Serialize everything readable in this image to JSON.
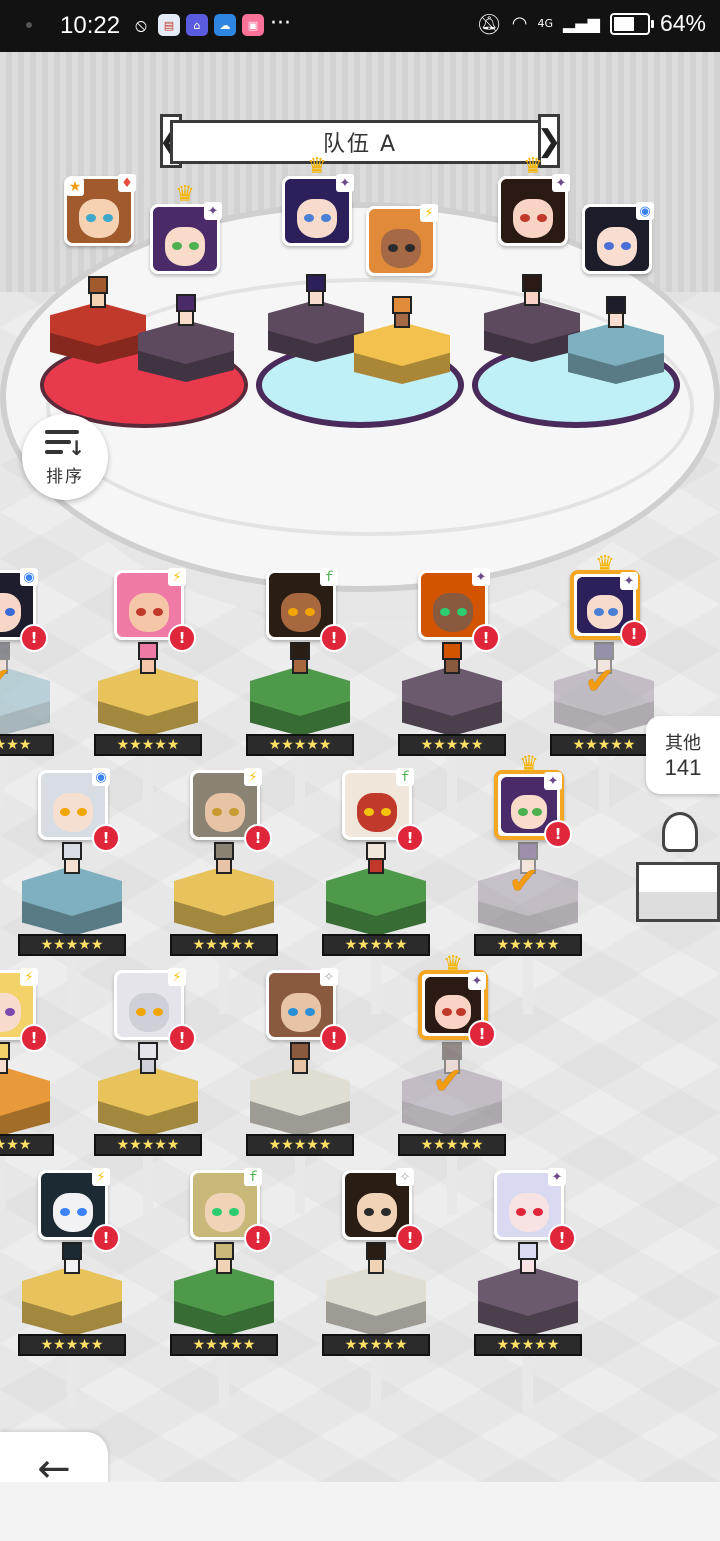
{
  "status_bar": {
    "time": "10:22",
    "network": "4G",
    "battery_percent": "64%",
    "battery_level": 0.64,
    "notification_icons": [
      "nosmoking-icon",
      "gift-icon",
      "wechat-work-icon",
      "cloud-icon",
      "bilibili-icon"
    ],
    "more": "···"
  },
  "team": {
    "title": "队伍 A",
    "prev_arrow": "❮",
    "next_arrow": "❯",
    "slots": [
      {
        "portrait_color": "#a05a2c",
        "skin": "#f6d2b3",
        "eye": "#3fa7c9",
        "element": "♦",
        "element_color": "#e74c3c",
        "rank_badge": "★",
        "pedestal_color": "#c0392b",
        "crown": false
      },
      {
        "portrait_color": "#4b2a6a",
        "skin": "#f8dcc9",
        "eye": "#4caf50",
        "element": "✦",
        "element_color": "#6b4a8a",
        "pedestal_color": "#5d4a5e",
        "crown": true
      },
      {
        "portrait_color": "#2c1f5a",
        "skin": "#f7dccd",
        "eye": "#4a7fd6",
        "element": "✦",
        "element_color": "#6b4a8a",
        "pedestal_color": "#5d4a5e",
        "crown": true
      },
      {
        "portrait_color": "#e08a3a",
        "skin": "#a56a45",
        "eye": "#2a2a2a",
        "element": "⚡",
        "element_color": "#f4c20d",
        "pedestal_color": "#f2c14e",
        "crown": false
      },
      {
        "portrait_color": "#2b1a14",
        "skin": "#f9d4c5",
        "eye": "#c0392b",
        "element": "✦",
        "element_color": "#6b4a8a",
        "pedestal_color": "#5d4a5e",
        "crown": true
      },
      {
        "portrait_color": "#1c1c2a",
        "skin": "#f9ddd0",
        "eye": "#4a6fd6",
        "element": "◉",
        "element_color": "#3b82f6",
        "pedestal_color": "#7fb0c0",
        "crown": false
      }
    ]
  },
  "roster": [
    {
      "hair": "#1d1d2e",
      "skin": "#f8d7c8",
      "eye": "#3b6bd6",
      "element": "◉",
      "element_color": "#3b82f6",
      "pedestal": "#7fb0c0",
      "alert": "!",
      "stars": "★★★★★",
      "check": true,
      "selected": false
    },
    {
      "hair": "#ef7aa6",
      "skin": "#f6c6a8",
      "eye": "#c0392b",
      "element": "⚡",
      "element_color": "#f4c20d",
      "pedestal": "#e8c25a",
      "alert": "!",
      "stars": "★★★★★",
      "check": false,
      "selected": false
    },
    {
      "hair": "#2a1d14",
      "skin": "#a8683f",
      "eye": "#f0a500",
      "element": "ｆ",
      "element_color": "#4caf50",
      "pedestal": "#4f9a4a",
      "alert": "!",
      "stars": "★★★★★",
      "check": false,
      "selected": false
    },
    {
      "hair": "#d35400",
      "skin": "#8a5a3e",
      "eye": "#2ecc71",
      "element": "✦",
      "element_color": "#6b4a8a",
      "pedestal": "#6b5a6d",
      "alert": "!",
      "stars": "★★★★★",
      "check": false,
      "selected": false
    },
    {
      "hair": "#2c1f5a",
      "skin": "#f7dccd",
      "eye": "#4a7fd6",
      "element": "✦",
      "element_color": "#6b4a8a",
      "pedestal": "#9a8a9c",
      "alert": "!",
      "stars": "★★★★★",
      "check": true,
      "selected": true,
      "crown": true
    },
    {
      "hair": "#d8dde4",
      "skin": "#f5dfd0",
      "eye": "#f0a500",
      "element": "◉",
      "element_color": "#3b82f6",
      "pedestal": "#7fb0c0",
      "alert": "!",
      "stars": "★★★★★",
      "check": false,
      "selected": false
    },
    {
      "hair": "#8a8272",
      "skin": "#e7c4a5",
      "eye": "#c89a30",
      "element": "⚡",
      "element_color": "#f4c20d",
      "pedestal": "#e8c25a",
      "alert": "!",
      "stars": "★★★★★",
      "check": false,
      "selected": false
    },
    {
      "hair": "#f1e6da",
      "skin": "#c0392b",
      "eye": "#f1c40f",
      "element": "ｆ",
      "element_color": "#4caf50",
      "pedestal": "#4f9a4a",
      "alert": "!",
      "stars": "★★★★★",
      "check": false,
      "selected": false
    },
    {
      "hair": "#4b2a6a",
      "skin": "#f8dcc9",
      "eye": "#4caf50",
      "element": "✦",
      "element_color": "#6b4a8a",
      "pedestal": "#9a8a9c",
      "alert": "!",
      "stars": "★★★★★",
      "check": true,
      "selected": true,
      "crown": true
    },
    {
      "hair": "#f4d26a",
      "skin": "#f7dccd",
      "eye": "#7a4ab0",
      "element": "⚡",
      "element_color": "#f4c20d",
      "pedestal": "#e89a3a",
      "alert": "!",
      "stars": "★★★★★",
      "check": false,
      "selected": false
    },
    {
      "hair": "#e4e4ea",
      "skin": "#cfcfd8",
      "eye": "#f0a500",
      "element": "⚡",
      "element_color": "#f4c20d",
      "pedestal": "#e8c25a",
      "alert": "!",
      "stars": "★★★★★",
      "check": false,
      "selected": false
    },
    {
      "hair": "#8a5a3e",
      "skin": "#e7c4a5",
      "eye": "#2b8fd6",
      "element": "✧",
      "element_color": "#aaaaaa",
      "pedestal": "#e0ddd2",
      "alert": "!",
      "stars": "★★★★★",
      "check": false,
      "selected": false
    },
    {
      "hair": "#2b1a14",
      "skin": "#f9d4c5",
      "eye": "#c0392b",
      "element": "✦",
      "element_color": "#6b4a8a",
      "pedestal": "#9a8a9c",
      "alert": "!",
      "stars": "★★★★★",
      "check": true,
      "selected": true,
      "crown": true
    },
    {
      "hair": "#1c2a33",
      "skin": "#f2f2f5",
      "eye": "#3b82f6",
      "element": "⚡",
      "element_color": "#f4c20d",
      "pedestal": "#e8c25a",
      "alert": "!",
      "stars": "★★★★★",
      "check": false,
      "selected": false
    },
    {
      "hair": "#c8b87a",
      "skin": "#f1d3b8",
      "eye": "#2ecc71",
      "element": "ｆ",
      "element_color": "#4caf50",
      "pedestal": "#4f9a4a",
      "alert": "!",
      "stars": "★★★★★",
      "check": false,
      "selected": false
    },
    {
      "hair": "#2a1d14",
      "skin": "#f1d3b8",
      "eye": "#2a2a2a",
      "element": "✧",
      "element_color": "#aaaaaa",
      "pedestal": "#e0ddd2",
      "alert": "!",
      "stars": "★★★★★",
      "check": false,
      "selected": false
    },
    {
      "hair": "#d9d9f2",
      "skin": "#f7e3e3",
      "eye": "#e0263b",
      "element": "✦",
      "element_color": "#6b4a8a",
      "pedestal": "#6b5a6d",
      "alert": "!",
      "stars": "★★★★★",
      "check": false,
      "selected": false
    }
  ],
  "sort": {
    "label": "排序"
  },
  "others": {
    "label": "其他",
    "count": "141"
  },
  "back": {
    "label": "返回",
    "arrow": "←"
  }
}
